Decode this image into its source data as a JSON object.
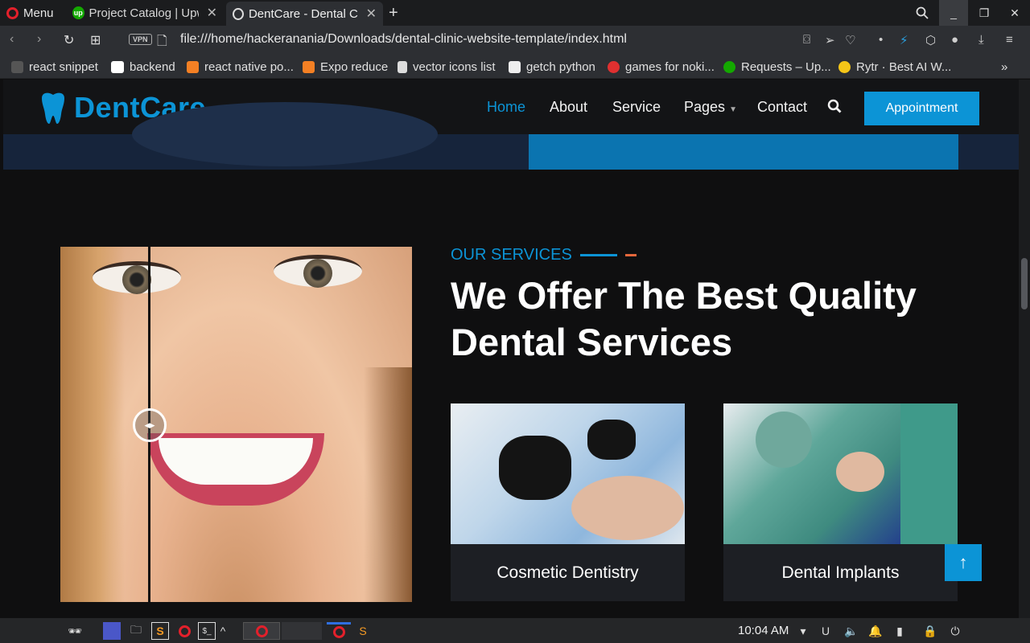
{
  "browser": {
    "menu_label": "Menu",
    "tabs": [
      {
        "title": "Project Catalog | Upw",
        "favicon": "upwork-icon"
      },
      {
        "title": "DentCare - Dental Cli",
        "favicon": "globe-icon",
        "active": true
      }
    ],
    "vpn_label": "VPN",
    "url": "file:///home/hackeranania/Downloads/dental-clinic-website-template/index.html",
    "bookmarks": [
      {
        "label": "react snippet",
        "icon": "page-icon"
      },
      {
        "label": "backend",
        "icon": "bit-icon"
      },
      {
        "label": "react native po...",
        "icon": "stackoverflow-icon"
      },
      {
        "label": "Expo reduce",
        "icon": "stackoverflow-icon"
      },
      {
        "label": "vector icons list",
        "icon": "document-icon"
      },
      {
        "label": "getch python",
        "icon": "cube-icon"
      },
      {
        "label": "games for noki...",
        "icon": "d-icon"
      },
      {
        "label": "Requests – Up...",
        "icon": "upwork-icon"
      },
      {
        "label": "Rytr · Best AI W...",
        "icon": "rytr-icon"
      }
    ]
  },
  "site": {
    "brand": "DentCare",
    "nav": [
      "Home",
      "About",
      "Service",
      "Pages",
      "Contact"
    ],
    "active_nav": "Home",
    "appointment_label": "Appointment",
    "eyebrow": "OUR SERVICES",
    "headline_line1": "We Offer The Best Quality",
    "headline_line2": "Dental Services",
    "services": [
      "Cosmetic Dentistry",
      "Dental Implants"
    ],
    "colors": {
      "accent": "#0c94d6",
      "accent2": "#e5673b",
      "background": "#0f0f10"
    }
  },
  "taskbar": {
    "clock": "10:04 AM"
  }
}
